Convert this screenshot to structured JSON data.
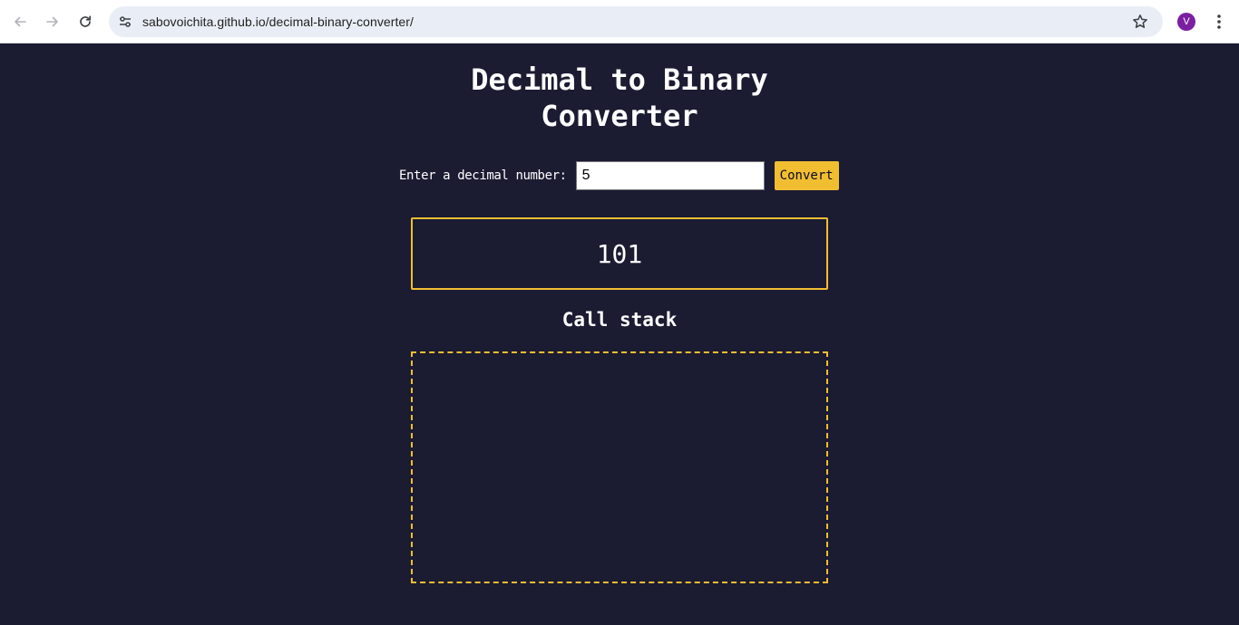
{
  "browser": {
    "url": "sabovoichita.github.io/decimal-binary-converter/",
    "profile_initial": "V",
    "profile_color": "#7b1fa2"
  },
  "page": {
    "title_line1": "Decimal to Binary",
    "title_line2": "Converter",
    "input_label": "Enter a decimal number:",
    "input_value": "5",
    "convert_label": "Convert",
    "result": "101",
    "call_stack_heading": "Call stack",
    "colors": {
      "background": "#1b1b32",
      "accent": "#f1be32",
      "text": "#ffffff"
    }
  }
}
